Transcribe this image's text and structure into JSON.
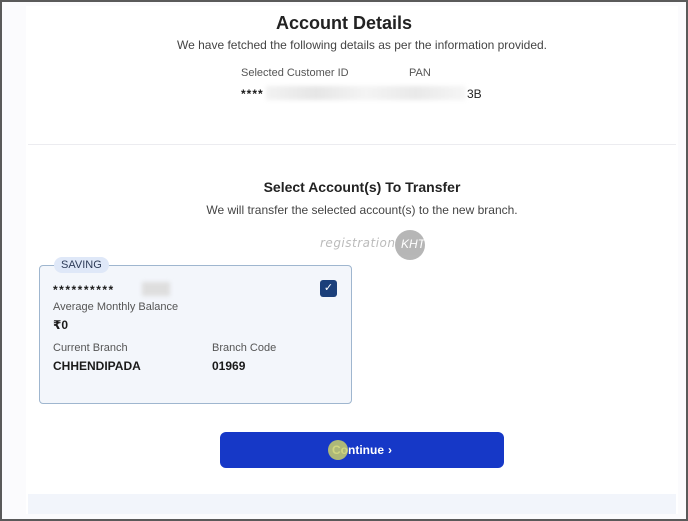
{
  "header": {
    "title": "Account Details",
    "subtitle": "We have fetched the following details as per the information provided."
  },
  "customer": {
    "cid_label": "Selected Customer ID",
    "pan_label": "PAN",
    "cid_value": "****",
    "pan_value_end": "3B"
  },
  "transfer": {
    "title": "Select Account(s) To Transfer",
    "subtitle": "We will transfer the selected account(s) to the new branch."
  },
  "watermark": {
    "text": "registration",
    "logo": "KHT"
  },
  "account_card": {
    "type_badge": "SAVING",
    "account_number": "**********",
    "checkbox_checked": true,
    "checkbox_icon": "check-icon",
    "avg_balance_label": "Average Monthly Balance",
    "avg_balance_value": "₹0",
    "branch_label": "Current Branch",
    "branch_value": "CHHENDIPADA",
    "branch_code_label": "Branch Code",
    "branch_code_value": "01969"
  },
  "actions": {
    "continue_label": "Continue",
    "continue_icon": "chevron-right-icon"
  },
  "colors": {
    "primary_button": "#1638c7",
    "checkbox": "#1b3f7a",
    "card_border": "#9fb6cf",
    "badge_bg": "#dfe8f8"
  }
}
